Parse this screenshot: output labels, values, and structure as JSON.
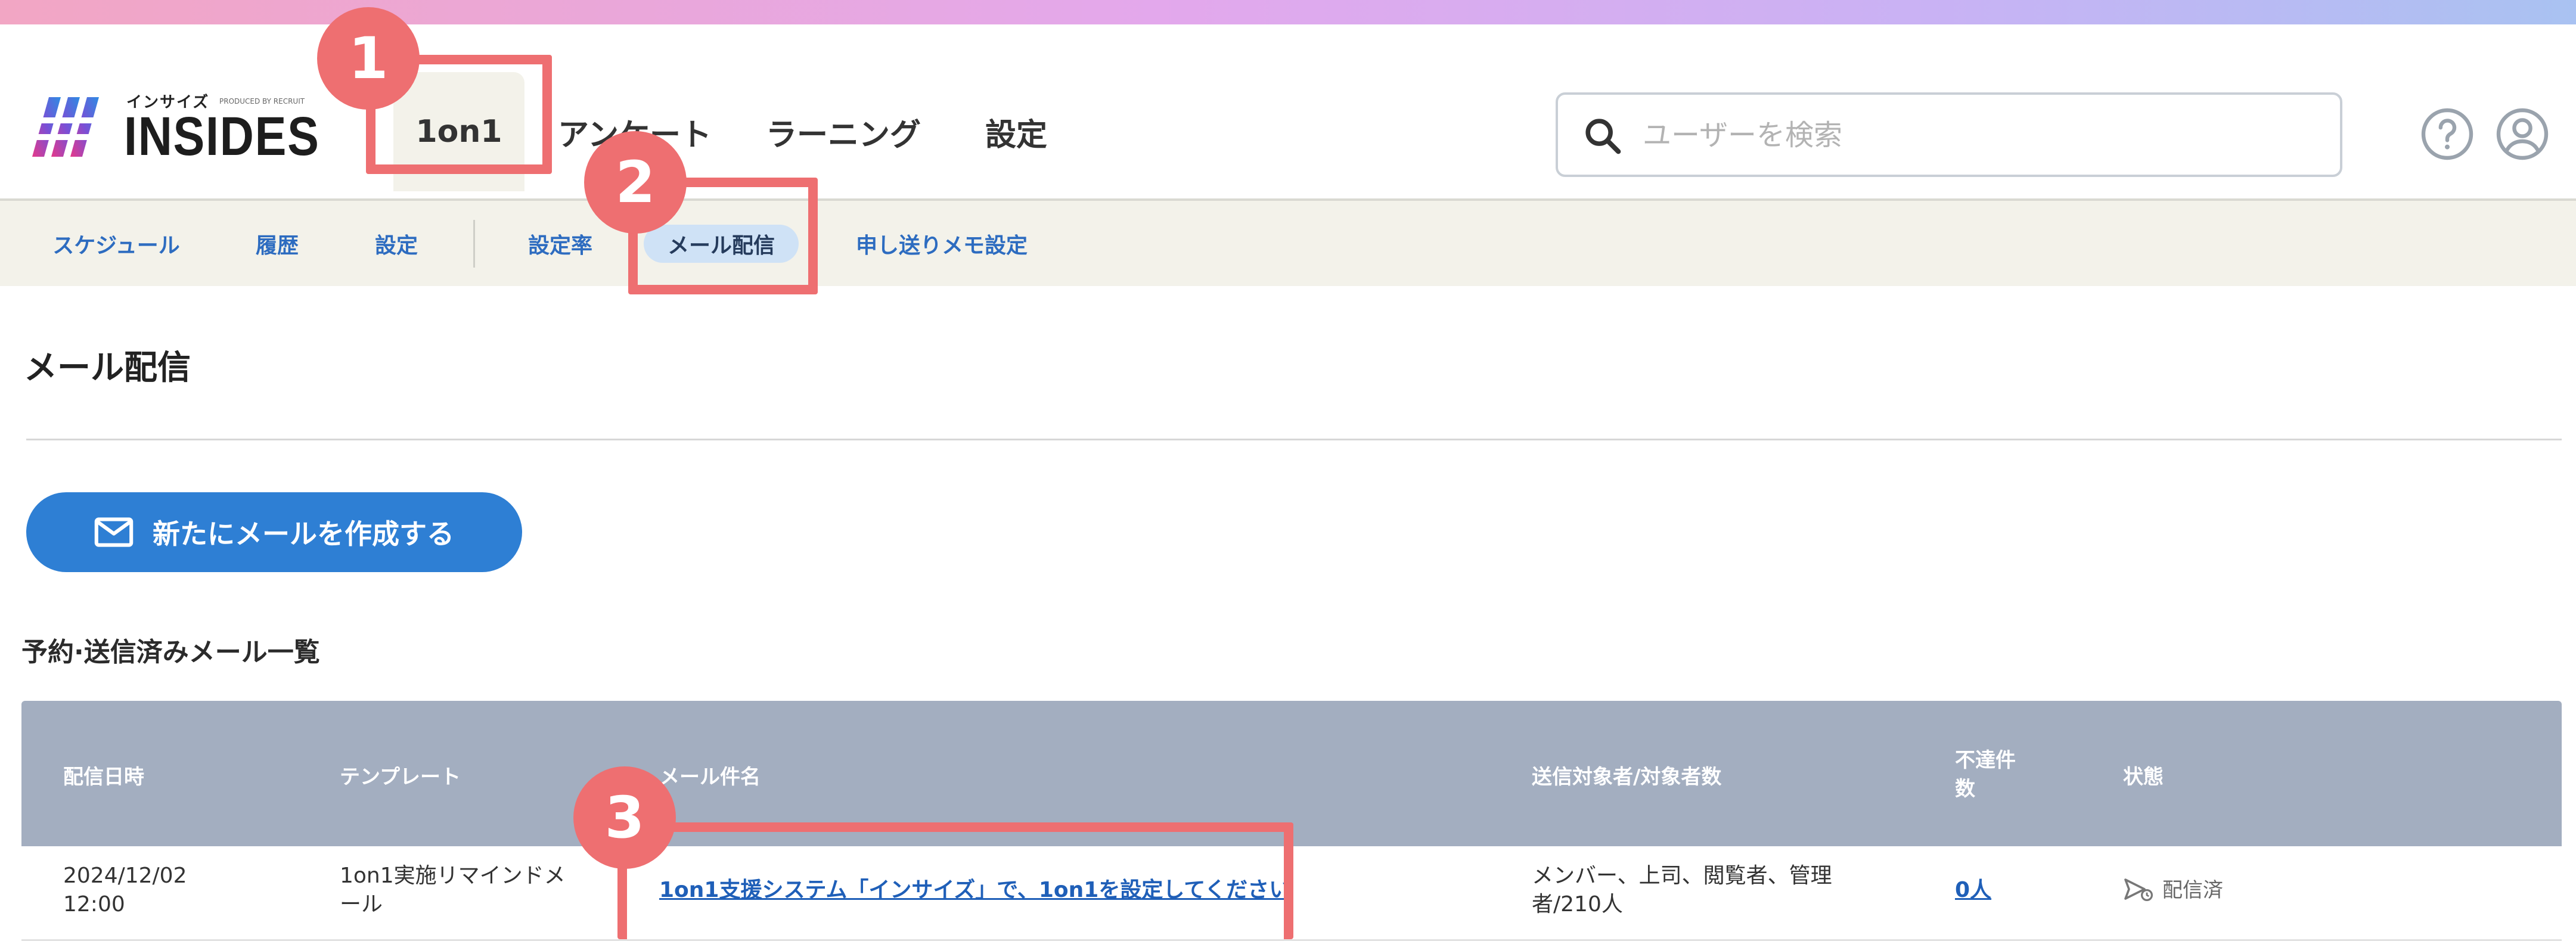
{
  "header": {
    "logo_kana": "インサイズ",
    "logo_produced": "PRODUCED BY RECRUIT",
    "logo_text": "INSIDES",
    "nav": [
      "1on1",
      "アンケート",
      "ラーニング",
      "設定"
    ],
    "search_placeholder": "ユーザーを検索",
    "icons": [
      "help-icon",
      "user-account-icon"
    ]
  },
  "subnav": {
    "items": [
      "スケジュール",
      "履歴",
      "設定",
      "設定率",
      "メール配信",
      "申し送りメモ設定"
    ],
    "active": "メール配信"
  },
  "main": {
    "title": "メール配信",
    "create_button": "新たにメールを作成する",
    "list_title": "予約·送信済みメール一覧"
  },
  "table": {
    "headers": [
      "配信日時",
      "テンプレート",
      "メール件名",
      "送信対象者/対象者数",
      "不達件数",
      "状態"
    ],
    "rows": [
      {
        "date_line1": "2024/12/02",
        "date_line2": "12:00",
        "template_line1": "1on1実施リマインドメ",
        "template_line2": "ール",
        "subject": "1on1支援システム「インサイズ」で、1on1を設定してください",
        "target_line1": "メンバー、上司、閲覧者、管理",
        "target_line2": "者/210人",
        "undelivered": "0人",
        "status": "配信済"
      }
    ]
  },
  "annotations": {
    "badges": [
      "1",
      "2",
      "3"
    ],
    "color": "#ee6f71"
  },
  "colors": {
    "primary_button": "#2e7fd4",
    "table_header": "#a3aec0",
    "subnav_bg": "#f3f2ea",
    "link": "#1f5fb8"
  }
}
